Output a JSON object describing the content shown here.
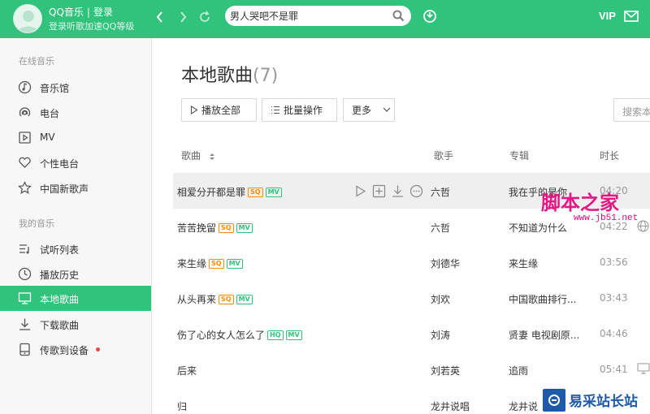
{
  "header": {
    "app_name": "QQ音乐",
    "login_label": "登录",
    "login_hint": "登录听歌加速QQ等级",
    "search_value": "男人哭吧不是罪",
    "vip_label": "VIP"
  },
  "sidebar": {
    "online_section": "在线音乐",
    "online_items": [
      {
        "label": "音乐馆",
        "icon": "music-hall-icon"
      },
      {
        "label": "电台",
        "icon": "radio-icon"
      },
      {
        "label": "MV",
        "icon": "mv-icon"
      },
      {
        "label": "个性电台",
        "icon": "heart-icon"
      },
      {
        "label": "中国新歌声",
        "icon": "star-icon"
      }
    ],
    "my_section": "我的音乐",
    "my_items": [
      {
        "label": "试听列表",
        "icon": "playlist-icon"
      },
      {
        "label": "播放历史",
        "icon": "clock-icon"
      },
      {
        "label": "本地歌曲",
        "icon": "monitor-icon",
        "active": true
      },
      {
        "label": "下载歌曲",
        "icon": "download-icon"
      },
      {
        "label": "传歌到设备",
        "icon": "device-icon"
      }
    ]
  },
  "main": {
    "title": "本地歌曲",
    "count": "(7)",
    "toolbar": {
      "play_all": "播放全部",
      "batch": "批量操作",
      "more": "更多"
    },
    "search_placeholder": "搜索本",
    "columns": {
      "song": "歌曲",
      "singer": "歌手",
      "album": "专辑",
      "duration": "时长"
    },
    "rows": [
      {
        "title": "相爱分开都是罪",
        "badges": [
          "SQ",
          "MV"
        ],
        "singer": "六哲",
        "album": "我在乎的是你",
        "duration": "04:20"
      },
      {
        "title": "苦苦挽留",
        "badges": [
          "SQ",
          "MV"
        ],
        "singer": "六哲",
        "album": "不知道为什么",
        "duration": "04:22"
      },
      {
        "title": "来生缘",
        "badges": [
          "SQ",
          "MV"
        ],
        "singer": "刘德华",
        "album": "来生缘",
        "duration": "03:56"
      },
      {
        "title": "从头再来",
        "badges": [
          "SQ",
          "MV"
        ],
        "singer": "刘欢",
        "album": "中国歌曲排行...",
        "duration": "03:43"
      },
      {
        "title": "伤了心的女人怎么了",
        "badges": [
          "HQ",
          "MV"
        ],
        "singer": "刘涛",
        "album": "贤妻 电视剧原...",
        "duration": "04:46"
      },
      {
        "title": "后来",
        "badges": [],
        "singer": "刘若英",
        "album": "追雨",
        "duration": "05:41"
      },
      {
        "title": "归",
        "badges": [],
        "singer": "龙井说唱",
        "album": "龙井说",
        "duration": ""
      }
    ]
  },
  "watermark": {
    "text": "脚本之家",
    "url": "www.jb51.net",
    "logo_text": "易采站长站"
  },
  "colors": {
    "brand": "#31c27c",
    "sq": "#ff8c00",
    "watermark": "#e6007a"
  }
}
